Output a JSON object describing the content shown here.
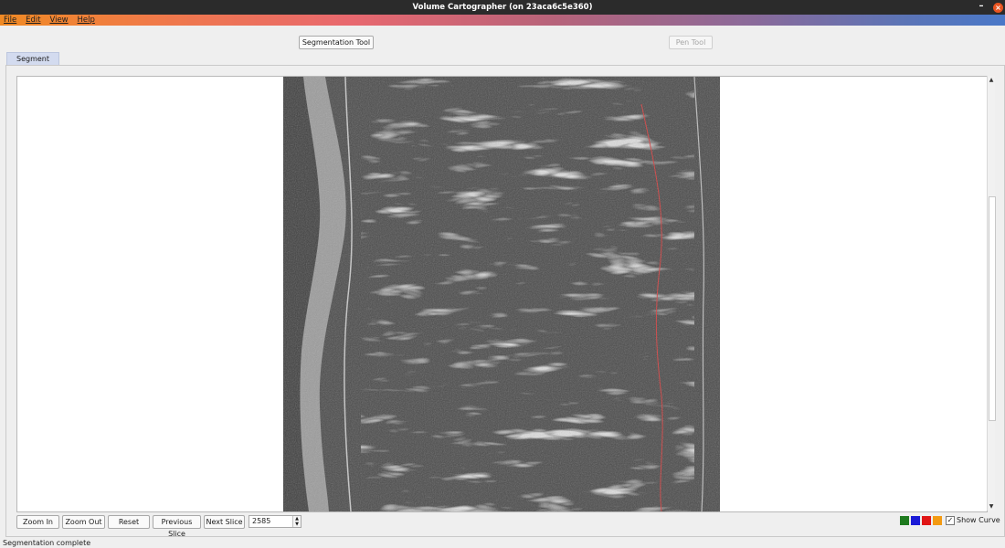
{
  "window": {
    "title": "Volume Cartographer (on 23aca6c5e360)",
    "minimize_icon": "minimize-icon",
    "close_icon": "close-icon"
  },
  "menu": {
    "items": [
      {
        "label": "File"
      },
      {
        "label": "Edit"
      },
      {
        "label": "View"
      },
      {
        "label": "Help"
      }
    ]
  },
  "toolbar": {
    "segmentation_tool": "Segmentation Tool",
    "pen_tool": "Pen Tool",
    "pen_tool_enabled": false
  },
  "tabs": [
    {
      "label": "Segment",
      "active": true
    }
  ],
  "viewer": {
    "content": "volume slice image (grayscale CT scan)",
    "curve_color": "#d23a3a"
  },
  "controls": {
    "zoom_in": "Zoom In",
    "zoom_out": "Zoom Out",
    "reset": "Reset",
    "previous_slice": "Previous Slice",
    "next_slice": "Next Slice",
    "slice_value": "2585"
  },
  "colors": [
    {
      "name": "green",
      "hex": "#1e7a1e"
    },
    {
      "name": "blue",
      "hex": "#1a1ad6"
    },
    {
      "name": "red",
      "hex": "#e01515"
    },
    {
      "name": "orange",
      "hex": "#f39a12"
    }
  ],
  "show_curve": {
    "label": "Show Curve",
    "checked": true
  },
  "status": {
    "text": "Segmentation complete"
  }
}
